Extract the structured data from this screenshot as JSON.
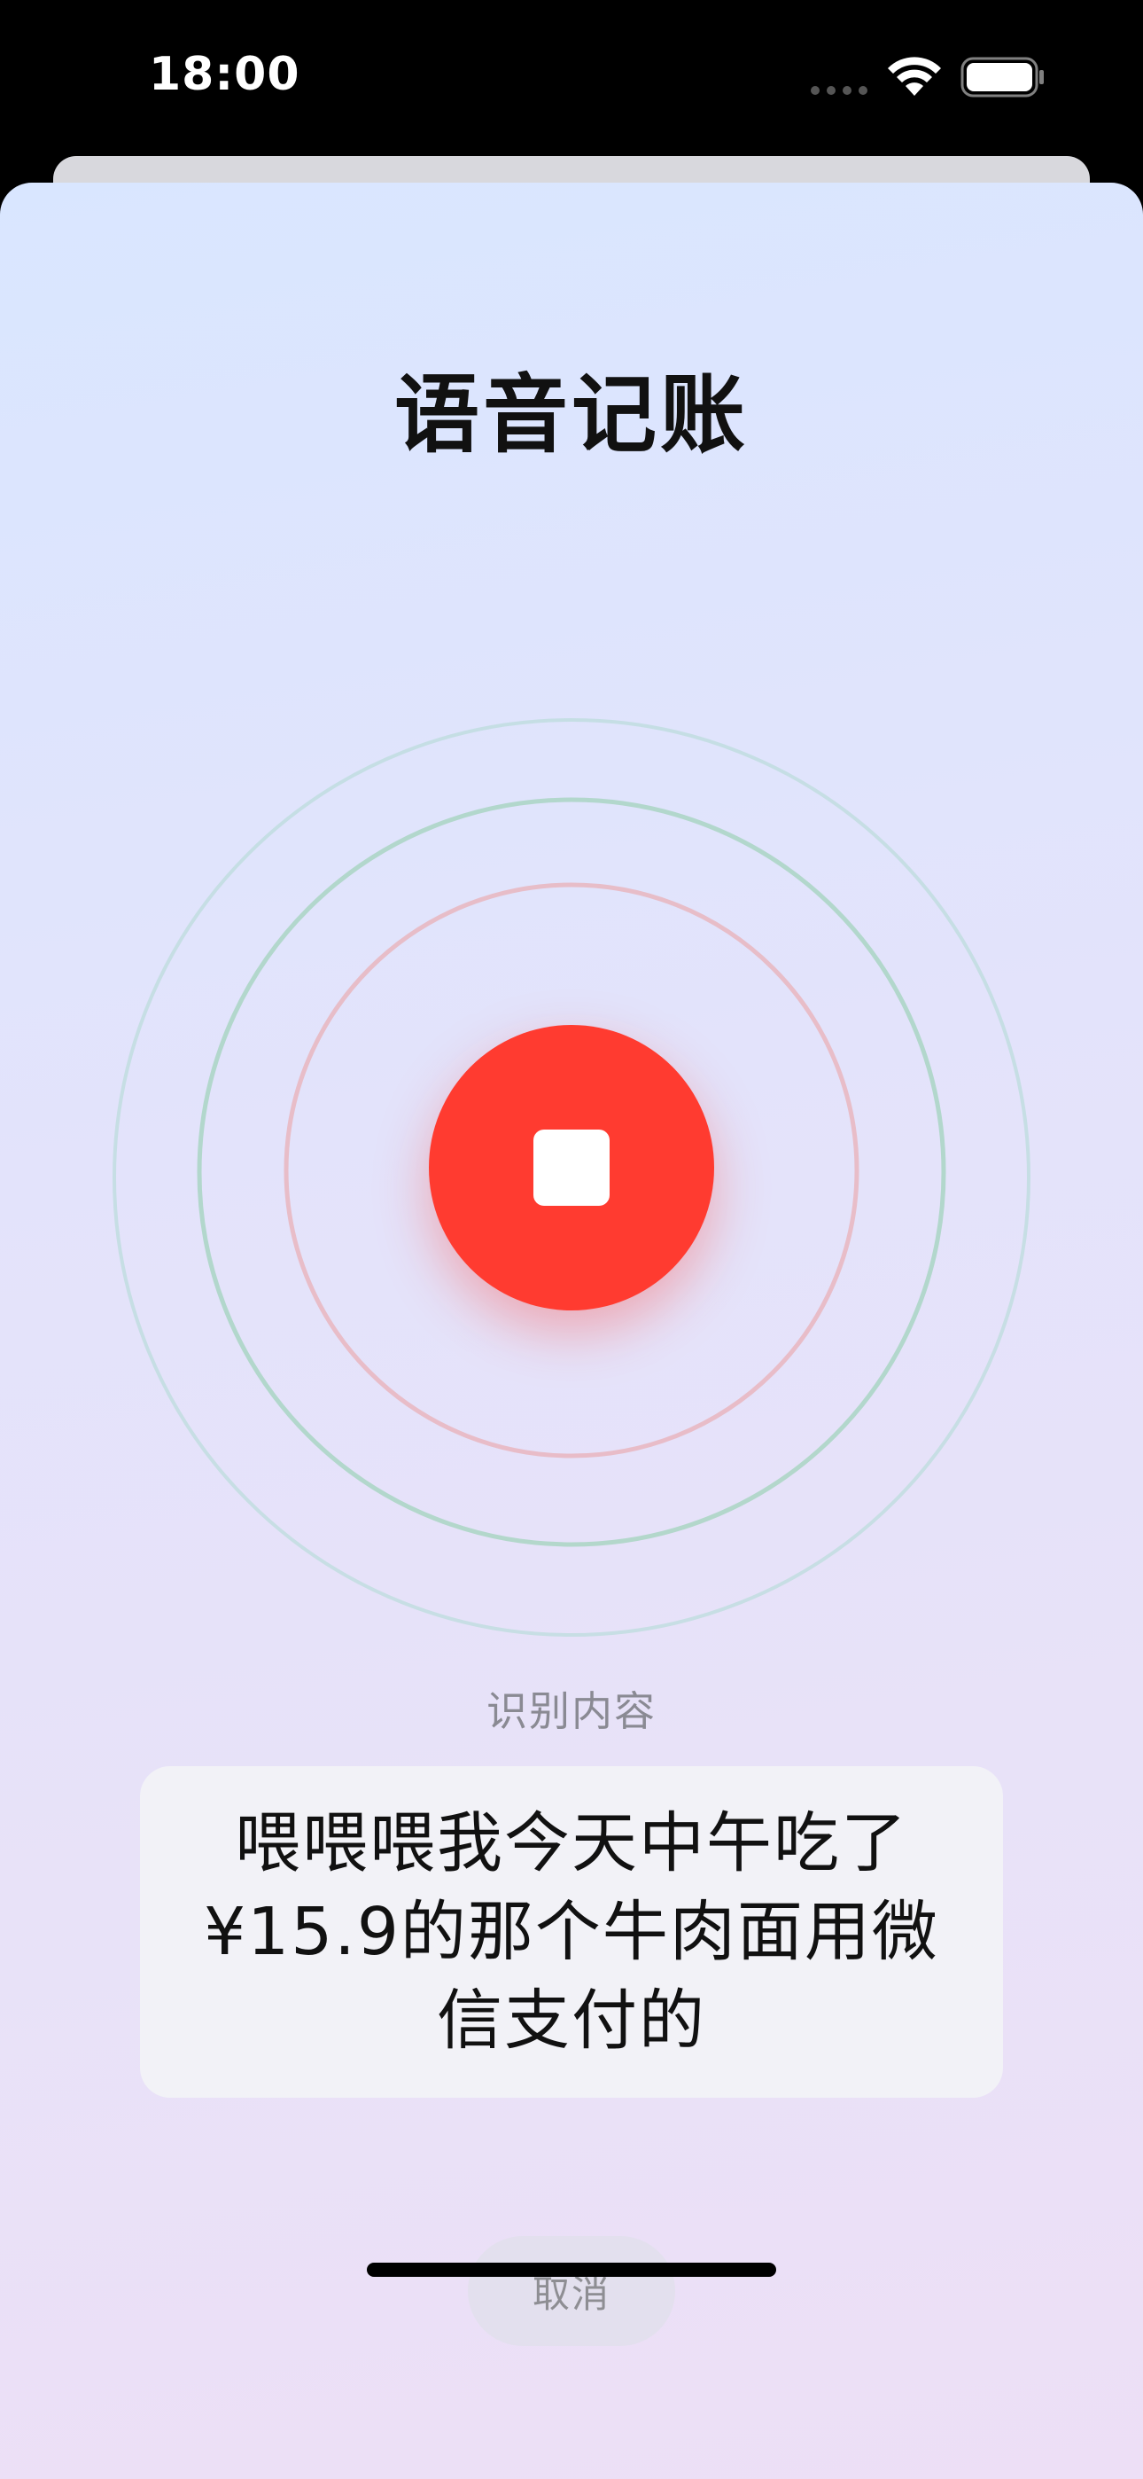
{
  "status_bar": {
    "time": "18:00"
  },
  "sheet": {
    "title": "语音记账"
  },
  "recorder": {
    "state": "recording",
    "button_icon": "stop-icon",
    "accent_color": "#ff3b30"
  },
  "recognition": {
    "label": "识别内容",
    "text": "喂喂喂我今天中午吃了¥15.9的那个牛肉面用微信支付的"
  },
  "actions": {
    "cancel_label": "取消"
  },
  "icons": [
    "wifi-icon",
    "battery-icon",
    "signal-dots-icon",
    "stop-icon"
  ]
}
